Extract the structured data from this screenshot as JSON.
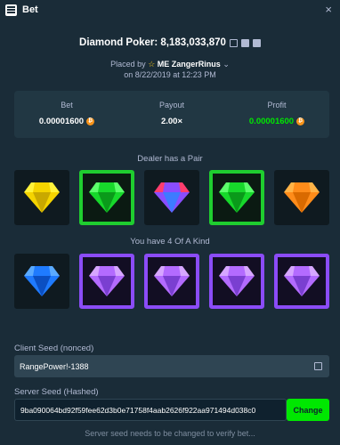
{
  "header": {
    "title": "Bet",
    "close": "×"
  },
  "game": {
    "title": "Diamond Poker: 8,183,033,870"
  },
  "placed": {
    "prefix": "Placed by",
    "user": "ME ZangerRinus",
    "caret": "⌄",
    "date": "on 8/22/2019 at 12:23 PM"
  },
  "stats": {
    "bet_label": "Bet",
    "bet_value": "0.00001600",
    "payout_label": "Payout",
    "payout_value": "2.00×",
    "profit_label": "Profit",
    "profit_value": "0.00001600",
    "currency_symbol": "₿"
  },
  "dealer": {
    "label": "Dealer has a Pair",
    "cards": [
      {
        "gem": "yellow",
        "frame": "plain"
      },
      {
        "gem": "green",
        "frame": "win-green"
      },
      {
        "gem": "rainbow",
        "frame": "plain"
      },
      {
        "gem": "green",
        "frame": "win-green"
      },
      {
        "gem": "orange",
        "frame": "plain"
      }
    ]
  },
  "player": {
    "label": "You have 4 Of A Kind",
    "cards": [
      {
        "gem": "blue",
        "frame": "plain"
      },
      {
        "gem": "purple",
        "frame": "win-purple"
      },
      {
        "gem": "purple",
        "frame": "win-purple"
      },
      {
        "gem": "purple",
        "frame": "win-purple"
      },
      {
        "gem": "purple",
        "frame": "win-purple"
      }
    ]
  },
  "gem_colors": {
    "yellow": [
      "#fff23a",
      "#f5d400",
      "#c9a800"
    ],
    "green": [
      "#5cff6b",
      "#17d82b",
      "#0a9a1a"
    ],
    "orange": [
      "#ffb347",
      "#ff8c1a",
      "#d96a00"
    ],
    "blue": [
      "#5aaaff",
      "#1f7bff",
      "#0b4fc2"
    ],
    "purple": [
      "#d6a6ff",
      "#b36bff",
      "#7a3fd1"
    ],
    "rainbow": [
      "#ff3d6e",
      "#8a4dff",
      "#3d7bff"
    ]
  },
  "seeds": {
    "client_label": "Client Seed (nonced)",
    "client_value": "RangePower!-1388",
    "server_label": "Server Seed (Hashed)",
    "server_value": "9ba090064bd92f59fee62d3b0e71758f4aab2626f922aa971494d038c0",
    "change_label": "Change",
    "note": "Server seed needs to be changed to verify bet..."
  },
  "colors": {
    "bg": "#1a2c38",
    "panel": "#213743",
    "green": "#00e701",
    "purple": "#8b4cf7"
  }
}
